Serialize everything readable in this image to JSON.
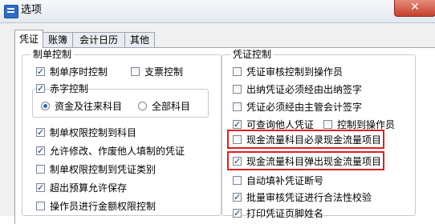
{
  "window": {
    "title": "选项",
    "close_glyph": "✕"
  },
  "tabs": [
    "凭证",
    "账簿",
    "会计日历",
    "其他"
  ],
  "left": {
    "group_title": "制单控制",
    "seq_control": {
      "label": "制单序时控制",
      "checked": true
    },
    "ticket_control": {
      "label": "支票控制",
      "checked": false
    },
    "red_group_title": "赤字控制",
    "red_enabled": {
      "checked": true
    },
    "radio_funds": {
      "label": "资金及往来科目",
      "selected": true
    },
    "radio_all": {
      "label": "全部科目",
      "selected": false
    },
    "items": [
      {
        "label": "制单权限控制到科目",
        "checked": true
      },
      {
        "label": "允许修改、作废他人填制的凭证",
        "checked": true
      },
      {
        "label": "制单权限控制到凭证类别",
        "checked": false
      },
      {
        "label": "超出预算允许保存",
        "checked": true
      },
      {
        "label": "操作员进行金额权限控制",
        "checked": false
      }
    ]
  },
  "right": {
    "group_title": "凭证控制",
    "items": [
      {
        "label": "凭证审核控制到操作员",
        "checked": false
      },
      {
        "label": "出纳凭证必须经由出纳签字",
        "checked": false
      },
      {
        "label": "凭证必须经由主管会计签字",
        "checked": false
      },
      {
        "label": "可查询他人凭证",
        "checked": true
      },
      {
        "label": "现金流量科目必录现金流量项目",
        "checked": false
      },
      {
        "label": "现金流量科目弹出现金流量项目",
        "checked": true
      },
      {
        "label": "自动填补凭证断号",
        "checked": false
      },
      {
        "label": "批量审核凭证进行合法性校验",
        "checked": true
      },
      {
        "label": "打印凭证页脚姓名",
        "checked": true
      }
    ],
    "query_to_operator": {
      "label": "控制到操作员",
      "checked": false
    }
  },
  "colors": {
    "highlight": "#e02020",
    "check": "#213a6b",
    "radio": "#2b66c0"
  }
}
